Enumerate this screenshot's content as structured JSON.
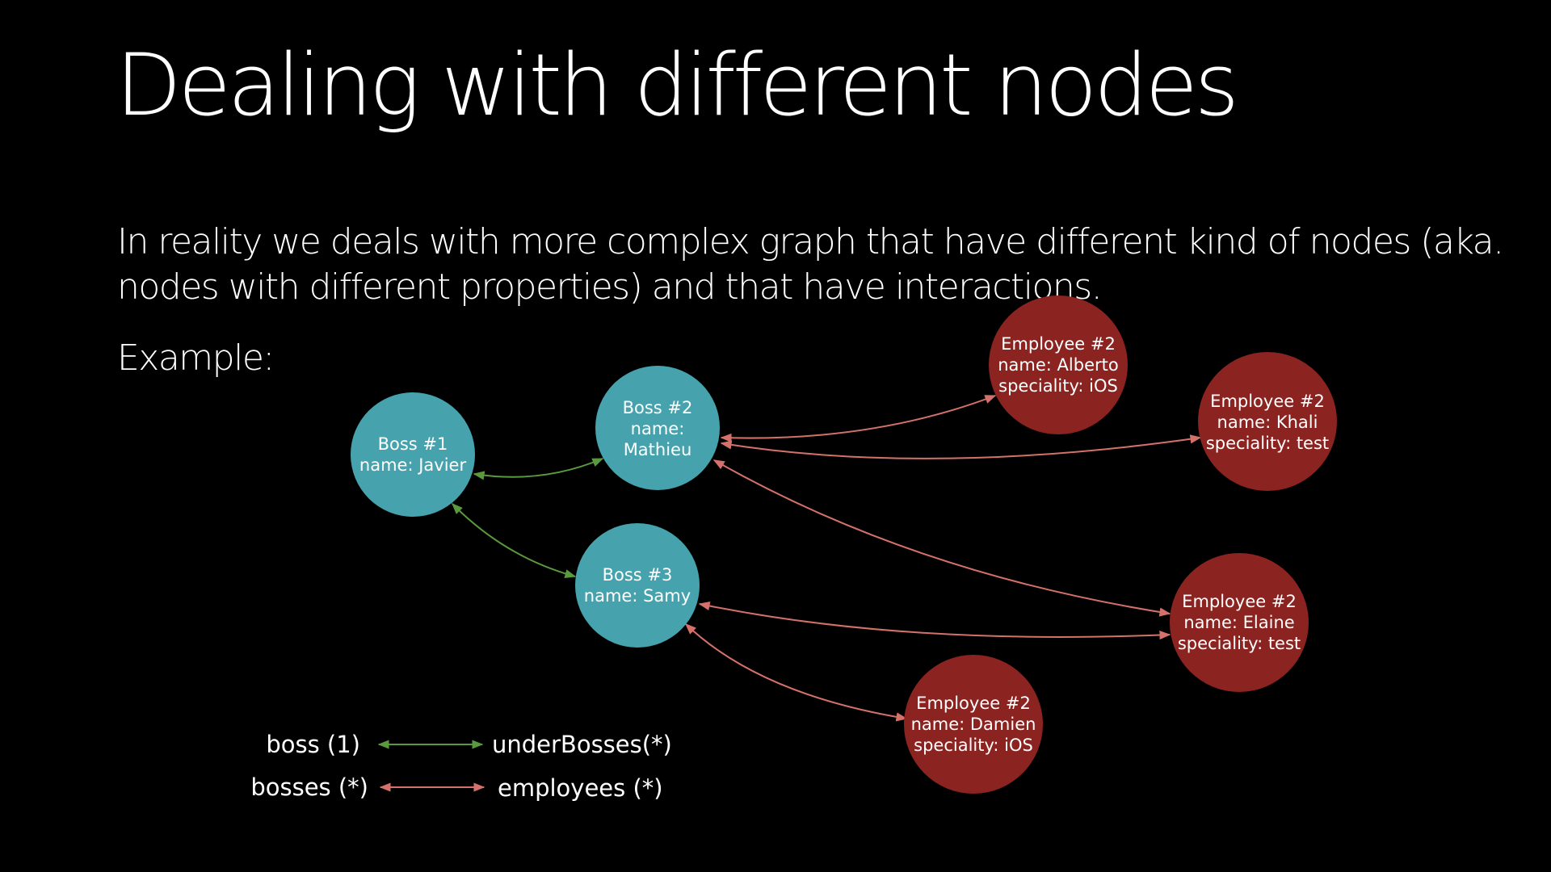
{
  "slide": {
    "title": "Dealing with different nodes",
    "subtitle": "In reality we deals with more complex graph that have different kind of nodes (aka. nodes with different properties) and that have interactions.",
    "example_label": "Example:"
  },
  "colors": {
    "boss_node": "#46a3ad",
    "employee_node": "#8b2320",
    "boss_edge": "#5a9a3e",
    "employee_edge": "#d4716a"
  },
  "nodes": {
    "boss1": {
      "line1": "Boss #1",
      "line2": "name: Javier"
    },
    "boss2": {
      "line1": "Boss #2",
      "line2": "name:",
      "line3": "Mathieu"
    },
    "boss3": {
      "line1": "Boss #3",
      "line2": "name: Samy"
    },
    "alberto": {
      "line1": "Employee #2",
      "line2": "name: Alberto",
      "line3": "speciality: iOS"
    },
    "khali": {
      "line1": "Employee #2",
      "line2": "name: Khali",
      "line3": "speciality: test"
    },
    "elaine": {
      "line1": "Employee #2",
      "line2": "name: Elaine",
      "line3": "speciality: test"
    },
    "damien": {
      "line1": "Employee #2",
      "line2": "name: Damien",
      "line3": "speciality: iOS"
    }
  },
  "legend": {
    "boss_left": "boss (1)",
    "boss_right": "underBosses(*)",
    "employee_left": "bosses (*)",
    "employee_right": "employees (*)"
  }
}
